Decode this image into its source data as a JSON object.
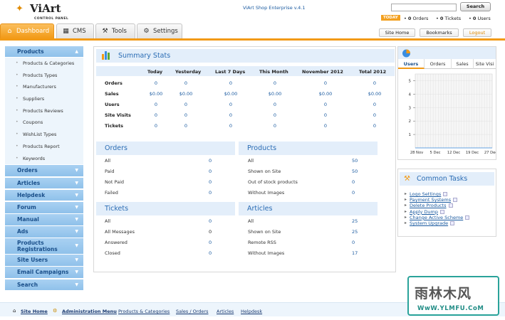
{
  "header": {
    "logo_name": "ViArt",
    "logo_sub": "CONTROL PANEL",
    "product": "ViArt Shop Enterprise v.4.1",
    "search_button": "Search",
    "today_badge": "TODAY",
    "counters": [
      {
        "value": "0",
        "label": "Orders"
      },
      {
        "value": "0",
        "label": "Tickets"
      },
      {
        "value": "0",
        "label": "Users"
      }
    ],
    "buttons": {
      "site_home": "Site Home",
      "bookmarks": "Bookmarks",
      "logout": "Logout"
    }
  },
  "tabs": [
    {
      "label": "Dashboard",
      "icon": "home-icon"
    },
    {
      "label": "CMS",
      "icon": "cms-icon"
    },
    {
      "label": "Tools",
      "icon": "tools-icon"
    },
    {
      "label": "Settings",
      "icon": "gear-icon"
    }
  ],
  "sidebar": {
    "products": {
      "label": "Products",
      "items": [
        "Products & Categories",
        "Products Types",
        "Manufacturers",
        "Suppliers",
        "Products Reviews",
        "Coupons",
        "WishList Types",
        "Products Report",
        "Keywords"
      ]
    },
    "sections": [
      "Orders",
      "Articles",
      "Helpdesk",
      "Forum",
      "Manual",
      "Ads",
      "Products Registrations",
      "Site Users",
      "Email Campaigns",
      "Search"
    ]
  },
  "summary": {
    "title": "Summary Stats",
    "columns": [
      "Today",
      "Yesterday",
      "Last 7 Days",
      "This Month",
      "November 2012",
      "Total 2012"
    ],
    "rows": [
      {
        "label": "Orders",
        "values": [
          "0",
          "0",
          "0",
          "0",
          "0",
          "0"
        ]
      },
      {
        "label": "Sales",
        "values": [
          "$0.00",
          "$0.00",
          "$0.00",
          "$0.00",
          "$0.00",
          "$0.00"
        ]
      },
      {
        "label": "Users",
        "values": [
          "0",
          "0",
          "0",
          "0",
          "0",
          "0"
        ]
      },
      {
        "label": "Site Visits",
        "values": [
          "0",
          "0",
          "0",
          "0",
          "0",
          "0"
        ]
      },
      {
        "label": "Tickets",
        "values": [
          "0",
          "0",
          "0",
          "0",
          "0",
          "0"
        ]
      }
    ]
  },
  "blocks": {
    "orders": {
      "title": "Orders",
      "rows": [
        {
          "l": "All",
          "v": "0"
        },
        {
          "l": "Paid",
          "v": "0"
        },
        {
          "l": "Not Paid",
          "v": "0"
        },
        {
          "l": "Failed",
          "v": "0"
        }
      ]
    },
    "products": {
      "title": "Products",
      "rows": [
        {
          "l": "All",
          "v": "50"
        },
        {
          "l": "Shown on Site",
          "v": "50"
        },
        {
          "l": "Out of stock products",
          "v": "0"
        },
        {
          "l": "Without Images",
          "v": "0"
        }
      ]
    },
    "tickets": {
      "title": "Tickets",
      "rows": [
        {
          "l": "All",
          "v": "0"
        },
        {
          "l": "All Messages",
          "v": "0"
        },
        {
          "l": "Answered",
          "v": "0"
        },
        {
          "l": "Closed",
          "v": "0"
        }
      ]
    },
    "articles": {
      "title": "Articles",
      "rows": [
        {
          "l": "All",
          "v": "25"
        },
        {
          "l": "Shown on Site",
          "v": "25"
        },
        {
          "l": "Remote RSS",
          "v": "0"
        },
        {
          "l": "Without Images",
          "v": "17"
        }
      ]
    }
  },
  "chart_panel": {
    "tabs": [
      "Users",
      "Orders",
      "Sales",
      "Site Visi"
    ]
  },
  "chart_data": {
    "type": "line",
    "x": [
      "28 Nov",
      "5 Dec",
      "12 Dec",
      "19 Dec",
      "27 Dec"
    ],
    "y_ticks": [
      "1",
      "2",
      "3",
      "4",
      "5"
    ],
    "ylim": [
      0,
      5.5
    ],
    "series": [
      {
        "values": [
          0,
          0,
          0,
          0,
          0
        ]
      }
    ]
  },
  "tasks": {
    "title": "Common Tasks",
    "items": [
      "Logo Settings",
      "Payment Systems",
      "Delete Products",
      "Apply Dump",
      "Change Active Scheme",
      "System Upgrade"
    ]
  },
  "footer": {
    "links": [
      "Site Home",
      "Administration Menu",
      "Products & Categories",
      "Sales / Orders",
      "Articles",
      "Helpdesk"
    ]
  },
  "watermark": {
    "line1": "雨林木风",
    "line2": "WwW.YLMFU.CoM"
  }
}
